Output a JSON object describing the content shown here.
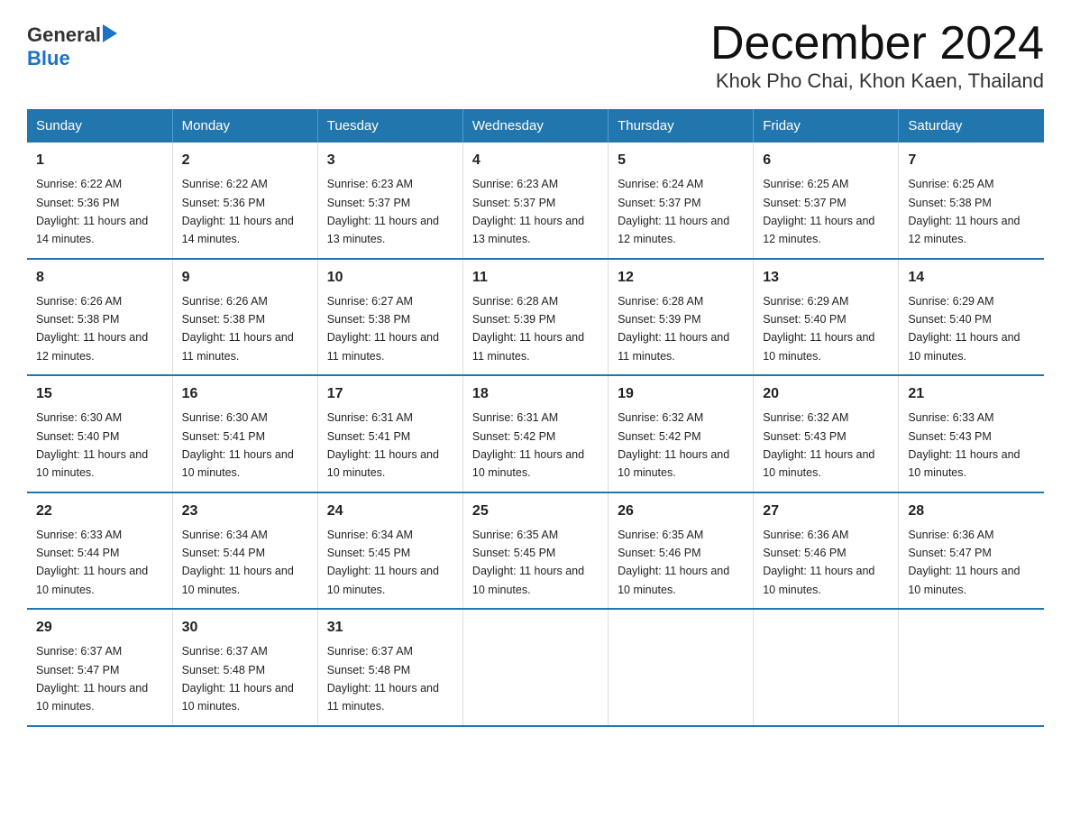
{
  "header": {
    "logo_line1": "General",
    "logo_line2": "Blue",
    "title": "December 2024",
    "subtitle": "Khok Pho Chai, Khon Kaen, Thailand"
  },
  "weekdays": [
    "Sunday",
    "Monday",
    "Tuesday",
    "Wednesday",
    "Thursday",
    "Friday",
    "Saturday"
  ],
  "weeks": [
    [
      {
        "day": "1",
        "sunrise": "6:22 AM",
        "sunset": "5:36 PM",
        "daylight": "11 hours and 14 minutes."
      },
      {
        "day": "2",
        "sunrise": "6:22 AM",
        "sunset": "5:36 PM",
        "daylight": "11 hours and 14 minutes."
      },
      {
        "day": "3",
        "sunrise": "6:23 AM",
        "sunset": "5:37 PM",
        "daylight": "11 hours and 13 minutes."
      },
      {
        "day": "4",
        "sunrise": "6:23 AM",
        "sunset": "5:37 PM",
        "daylight": "11 hours and 13 minutes."
      },
      {
        "day": "5",
        "sunrise": "6:24 AM",
        "sunset": "5:37 PM",
        "daylight": "11 hours and 12 minutes."
      },
      {
        "day": "6",
        "sunrise": "6:25 AM",
        "sunset": "5:37 PM",
        "daylight": "11 hours and 12 minutes."
      },
      {
        "day": "7",
        "sunrise": "6:25 AM",
        "sunset": "5:38 PM",
        "daylight": "11 hours and 12 minutes."
      }
    ],
    [
      {
        "day": "8",
        "sunrise": "6:26 AM",
        "sunset": "5:38 PM",
        "daylight": "11 hours and 12 minutes."
      },
      {
        "day": "9",
        "sunrise": "6:26 AM",
        "sunset": "5:38 PM",
        "daylight": "11 hours and 11 minutes."
      },
      {
        "day": "10",
        "sunrise": "6:27 AM",
        "sunset": "5:38 PM",
        "daylight": "11 hours and 11 minutes."
      },
      {
        "day": "11",
        "sunrise": "6:28 AM",
        "sunset": "5:39 PM",
        "daylight": "11 hours and 11 minutes."
      },
      {
        "day": "12",
        "sunrise": "6:28 AM",
        "sunset": "5:39 PM",
        "daylight": "11 hours and 11 minutes."
      },
      {
        "day": "13",
        "sunrise": "6:29 AM",
        "sunset": "5:40 PM",
        "daylight": "11 hours and 10 minutes."
      },
      {
        "day": "14",
        "sunrise": "6:29 AM",
        "sunset": "5:40 PM",
        "daylight": "11 hours and 10 minutes."
      }
    ],
    [
      {
        "day": "15",
        "sunrise": "6:30 AM",
        "sunset": "5:40 PM",
        "daylight": "11 hours and 10 minutes."
      },
      {
        "day": "16",
        "sunrise": "6:30 AM",
        "sunset": "5:41 PM",
        "daylight": "11 hours and 10 minutes."
      },
      {
        "day": "17",
        "sunrise": "6:31 AM",
        "sunset": "5:41 PM",
        "daylight": "11 hours and 10 minutes."
      },
      {
        "day": "18",
        "sunrise": "6:31 AM",
        "sunset": "5:42 PM",
        "daylight": "11 hours and 10 minutes."
      },
      {
        "day": "19",
        "sunrise": "6:32 AM",
        "sunset": "5:42 PM",
        "daylight": "11 hours and 10 minutes."
      },
      {
        "day": "20",
        "sunrise": "6:32 AM",
        "sunset": "5:43 PM",
        "daylight": "11 hours and 10 minutes."
      },
      {
        "day": "21",
        "sunrise": "6:33 AM",
        "sunset": "5:43 PM",
        "daylight": "11 hours and 10 minutes."
      }
    ],
    [
      {
        "day": "22",
        "sunrise": "6:33 AM",
        "sunset": "5:44 PM",
        "daylight": "11 hours and 10 minutes."
      },
      {
        "day": "23",
        "sunrise": "6:34 AM",
        "sunset": "5:44 PM",
        "daylight": "11 hours and 10 minutes."
      },
      {
        "day": "24",
        "sunrise": "6:34 AM",
        "sunset": "5:45 PM",
        "daylight": "11 hours and 10 minutes."
      },
      {
        "day": "25",
        "sunrise": "6:35 AM",
        "sunset": "5:45 PM",
        "daylight": "11 hours and 10 minutes."
      },
      {
        "day": "26",
        "sunrise": "6:35 AM",
        "sunset": "5:46 PM",
        "daylight": "11 hours and 10 minutes."
      },
      {
        "day": "27",
        "sunrise": "6:36 AM",
        "sunset": "5:46 PM",
        "daylight": "11 hours and 10 minutes."
      },
      {
        "day": "28",
        "sunrise": "6:36 AM",
        "sunset": "5:47 PM",
        "daylight": "11 hours and 10 minutes."
      }
    ],
    [
      {
        "day": "29",
        "sunrise": "6:37 AM",
        "sunset": "5:47 PM",
        "daylight": "11 hours and 10 minutes."
      },
      {
        "day": "30",
        "sunrise": "6:37 AM",
        "sunset": "5:48 PM",
        "daylight": "11 hours and 10 minutes."
      },
      {
        "day": "31",
        "sunrise": "6:37 AM",
        "sunset": "5:48 PM",
        "daylight": "11 hours and 11 minutes."
      },
      null,
      null,
      null,
      null
    ]
  ]
}
